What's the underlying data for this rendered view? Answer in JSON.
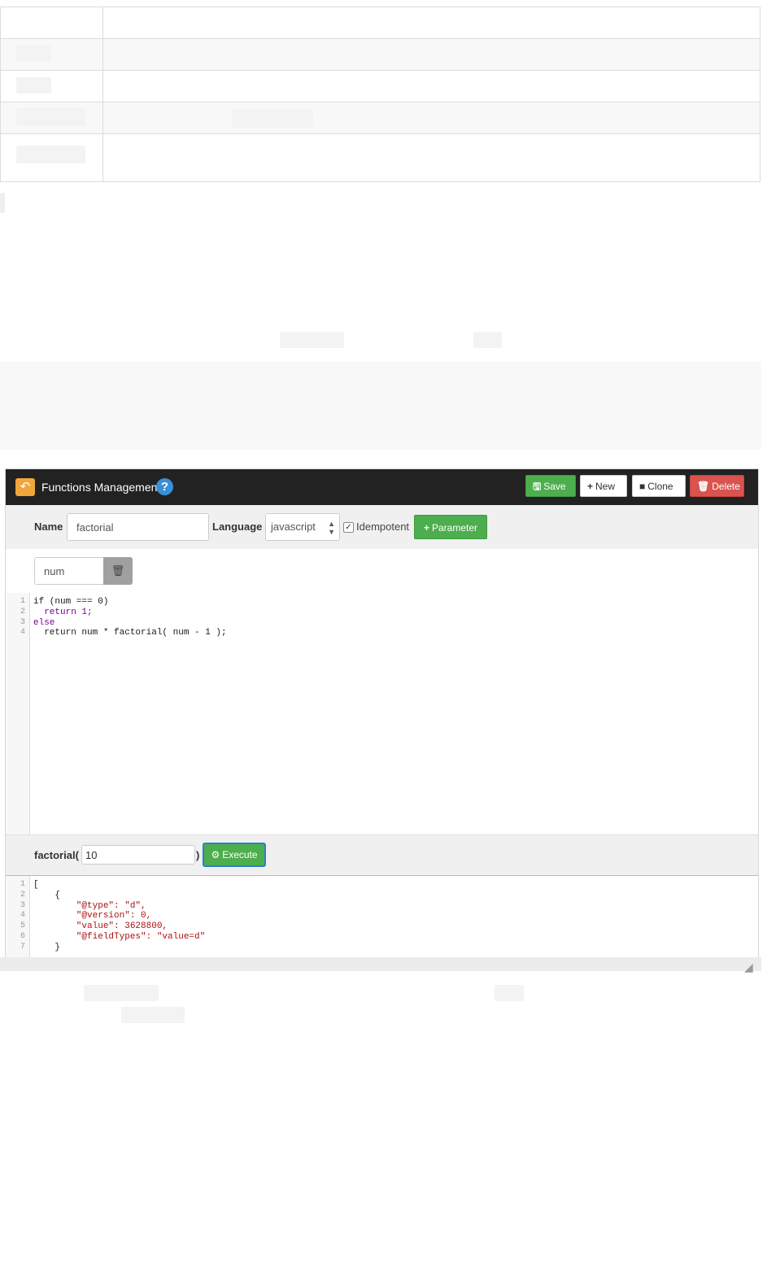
{
  "header": {
    "title": "Functions Management",
    "help_glyph": "?",
    "save_label": "Save",
    "new_label": "New",
    "clone_label": "Clone",
    "delete_label": "Delete"
  },
  "form": {
    "name_label": "Name",
    "name_value": "factorial",
    "language_label": "Language",
    "language_value": "javascript",
    "idempotent_label": "Idempotent",
    "idempotent_checked": true,
    "parameter_button": "Parameter"
  },
  "parameters": [
    {
      "name": "num"
    }
  ],
  "code_lines": [
    {
      "n": "1",
      "text": "if (num === 0)"
    },
    {
      "n": "2",
      "text": "  return 1;"
    },
    {
      "n": "3",
      "text": "else"
    },
    {
      "n": "4",
      "text": "  return num * factorial( num - 1 );"
    }
  ],
  "execute": {
    "call_prefix": "factorial(",
    "argument": "10",
    "call_suffix": ")",
    "button_label": "Execute"
  },
  "output_lines": [
    {
      "n": "1",
      "text": "["
    },
    {
      "n": "2",
      "text": "    {"
    },
    {
      "n": "3",
      "text": "        \"@type\": \"d\","
    },
    {
      "n": "4",
      "text": "        \"@version\": 0,"
    },
    {
      "n": "5",
      "text": "        \"value\": 3628800,"
    },
    {
      "n": "6",
      "text": "        \"@fieldTypes\": \"value=d\""
    },
    {
      "n": "7",
      "text": "    }"
    }
  ],
  "colors": {
    "header_bg": "#222222",
    "accent_orange": "#f0a63b",
    "success_green": "#4cae4c",
    "danger_red": "#d9534f",
    "help_blue": "#3a8fd6"
  },
  "icons": {
    "back": "back-arrow-icon",
    "help": "question-circle-icon",
    "save": "floppy-disk-icon",
    "new": "plus-icon",
    "clone": "file-icon",
    "delete": "trash-icon",
    "parameter": "plus-icon",
    "remove_param": "trash-icon",
    "execute": "gear-icon",
    "select": "updown-arrows-icon",
    "resize": "resize-grip-icon"
  }
}
